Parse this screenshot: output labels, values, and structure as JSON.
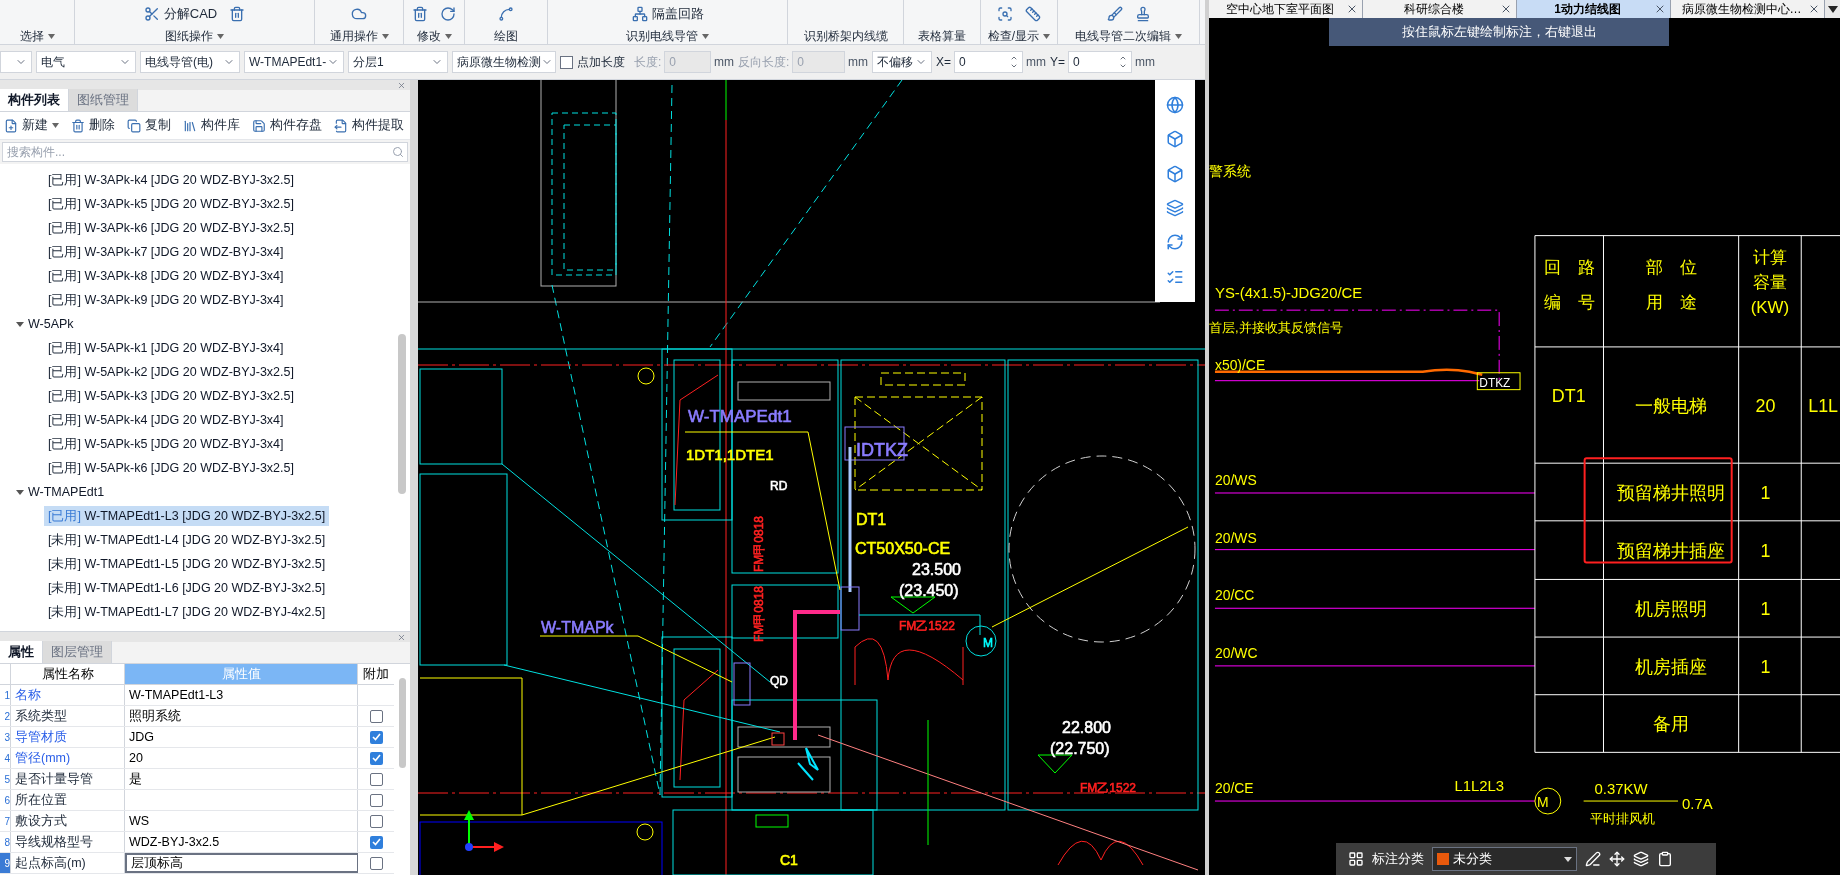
{
  "ribbon": {
    "groups": [
      {
        "label": "选择"
      },
      {
        "label": "图纸操作",
        "tools": [
          {
            "label": "分解CAD"
          }
        ]
      },
      {
        "label": "通用操作"
      },
      {
        "label": "修改"
      },
      {
        "label": "绘图"
      },
      {
        "label": "识别电线导管",
        "tools": [
          {
            "label": "隔盖回路"
          }
        ]
      },
      {
        "label": "识别桥架内线缆"
      },
      {
        "label": "表格算量"
      },
      {
        "label": "检查/显示"
      },
      {
        "label": "电线导管二次编辑"
      }
    ]
  },
  "options_bar": [
    {
      "kind": "select"
    },
    {
      "kind": "select",
      "value": "电气"
    },
    {
      "kind": "select",
      "value": "电线导管(电)"
    },
    {
      "kind": "select",
      "value": "W-TMAPEdt1-"
    },
    {
      "kind": "select",
      "value": "分层1"
    },
    {
      "kind": "select",
      "value": "病原微生物检测"
    },
    {
      "kind": "checkbox",
      "label": "点加长度",
      "checked": false
    },
    {
      "kind": "field",
      "label": "长度:",
      "value": "0",
      "unit": "mm",
      "disabled": true
    },
    {
      "kind": "field",
      "label": "反向长度:",
      "value": "0",
      "unit": "mm",
      "disabled": true
    },
    {
      "kind": "select",
      "value": "不偏移"
    },
    {
      "kind": "spin",
      "label": "X=",
      "value": "0",
      "unit": "mm"
    },
    {
      "kind": "spin",
      "label": "Y=",
      "value": "0",
      "unit": "mm"
    }
  ],
  "component_panel": {
    "tabs": [
      {
        "label": "构件列表",
        "selected": true
      },
      {
        "label": "图纸管理",
        "selected": false
      }
    ],
    "toolbar": [
      {
        "label": "新建",
        "caret": true
      },
      {
        "label": "删除"
      },
      {
        "label": "复制"
      },
      {
        "label": "构件库"
      },
      {
        "label": "构件存盘"
      },
      {
        "label": "构件提取"
      }
    ],
    "search": {
      "placeholder": "搜索构件..."
    },
    "tree": [
      {
        "children": [
          {
            "label": "[已用] W-3APk-k4 [JDG 20 WDZ-BYJ-3x2.5]",
            "selected": false
          },
          {
            "label": "[已用] W-3APk-k5 [JDG 20 WDZ-BYJ-3x2.5]",
            "selected": false
          },
          {
            "label": "[已用] W-3APk-k6 [JDG 20 WDZ-BYJ-3x2.5]",
            "selected": false
          },
          {
            "label": "[已用] W-3APk-k7 [JDG 20 WDZ-BYJ-3x4]",
            "selected": false
          },
          {
            "label": "[已用] W-3APk-k8 [JDG 20 WDZ-BYJ-3x4]",
            "selected": false
          },
          {
            "label": "[已用] W-3APk-k9 [JDG 20 WDZ-BYJ-3x4]",
            "selected": false
          }
        ]
      },
      {
        "label": "W-5APk",
        "expanded": true,
        "children": [
          {
            "label": "[已用] W-5APk-k1 [JDG 20 WDZ-BYJ-3x4]",
            "selected": false
          },
          {
            "label": "[已用] W-5APk-k2 [JDG 20 WDZ-BYJ-3x2.5]",
            "selected": false
          },
          {
            "label": "[已用] W-5APk-k3 [JDG 20 WDZ-BYJ-3x2.5]",
            "selected": false
          },
          {
            "label": "[已用] W-5APk-k4 [JDG 20 WDZ-BYJ-3x4]",
            "selected": false
          },
          {
            "label": "[已用] W-5APk-k5 [JDG 20 WDZ-BYJ-3x4]",
            "selected": false
          },
          {
            "label": "[已用] W-5APk-k6 [JDG 20 WDZ-BYJ-3x2.5]",
            "selected": false
          }
        ]
      },
      {
        "label": "W-TMAPEdt1",
        "expanded": true,
        "children": [
          {
            "label": "[已用] W-TMAPEdt1-L3 [JDG 20 WDZ-BYJ-3x2.5]",
            "selected": true
          },
          {
            "label": "[未用] W-TMAPEdt1-L4 [JDG 20 WDZ-BYJ-3x2.5]",
            "selected": false
          },
          {
            "label": "[未用] W-TMAPEdt1-L5 [JDG 20 WDZ-BYJ-3x2.5]",
            "selected": false
          },
          {
            "label": "[未用] W-TMAPEdt1-L6 [JDG 20 WDZ-BYJ-3x2.5]",
            "selected": false
          },
          {
            "label": "[未用] W-TMAPEdt1-L7 [JDG 20 WDZ-BYJ-4x2.5]",
            "selected": false
          }
        ]
      }
    ]
  },
  "property_panel": {
    "tabs": [
      {
        "label": "属性",
        "selected": true
      },
      {
        "label": "图层管理",
        "selected": false
      }
    ],
    "columns": [
      "属性名称",
      "属性值",
      "附加"
    ],
    "rows": [
      {
        "no": "1",
        "name": "名称",
        "value": "W-TMAPEdt1-L3",
        "highlighted": true,
        "editing": false
      },
      {
        "no": "2",
        "name": "系统类型",
        "value": "照明系统",
        "checked": false,
        "highlighted": false,
        "editing": false
      },
      {
        "no": "3",
        "name": "导管材质",
        "value": "JDG",
        "checked": true,
        "highlighted": true,
        "editing": false
      },
      {
        "no": "4",
        "name": "管径(mm)",
        "value": "20",
        "checked": true,
        "highlighted": true,
        "editing": false
      },
      {
        "no": "5",
        "name": "是否计量导管",
        "value": "是",
        "checked": false,
        "highlighted": false,
        "editing": false
      },
      {
        "no": "6",
        "name": "所在位置",
        "checked": false,
        "highlighted": false,
        "editing": false
      },
      {
        "no": "7",
        "name": "敷设方式",
        "value": "WS",
        "checked": false,
        "highlighted": false,
        "editing": false
      },
      {
        "no": "8",
        "name": "导线规格型号",
        "value": "WDZ-BYJ-3x2.5",
        "checked": true,
        "highlighted": false,
        "editing": false
      },
      {
        "no": "9",
        "name": "起点标高(m)",
        "value": "层顶标高",
        "checked": false,
        "highlighted": false,
        "editing": true
      }
    ]
  },
  "plan_labels": [
    {
      "text": "W-TMAPEdt1",
      "color": "#8a7cff"
    },
    {
      "text": "1DT1,1DTE1",
      "color": "#ffff00"
    },
    {
      "text": "RD",
      "color": "#ffffff"
    },
    {
      "text": "IDTKZ",
      "color": "#8a7cff"
    },
    {
      "text": "DT1",
      "color": "#ffff00"
    },
    {
      "text": "CT50X50-CE",
      "color": "#ffff00"
    },
    {
      "text": "23.500",
      "color": "#ffffff"
    },
    {
      "text": "(23.450)",
      "color": "#ffffff"
    },
    {
      "text": "FM甲0818",
      "color": "#ff2020"
    },
    {
      "text": "FM甲0818",
      "color": "#ff2020"
    },
    {
      "text": "W-TMAPk",
      "color": "#8a7cff"
    },
    {
      "text": "FM乙1522",
      "color": "#ff2020"
    },
    {
      "text": "QD",
      "color": "#ffffff"
    },
    {
      "text": "22.800",
      "color": "#ffffff"
    },
    {
      "text": "(22.750)",
      "color": "#ffffff"
    },
    {
      "text": "FM乙1522",
      "color": "#ff2020"
    },
    {
      "text": "M",
      "color": "#00ffff"
    },
    {
      "text": "C1",
      "color": "#ffff00"
    }
  ],
  "drawing_tabs": [
    {
      "label": "空中心地下室平面图",
      "selected": false
    },
    {
      "label": "科研综合楼",
      "selected": false
    },
    {
      "label": "1动力结线图",
      "selected": true
    },
    {
      "label": "病原微生物检测中心…",
      "selected": false
    }
  ],
  "hint_banner": "按住鼠标左键绘制标注，右键退出",
  "diagram_labels": [
    "警系统",
    "YS-(4x1.5)-JDG20/CE",
    "首层,并接收其反馈信号",
    "x50)/CE",
    "DTKZ",
    "20/WS",
    "20/WS",
    "20/CC",
    "20/WC",
    "20/CE",
    "L1L2L3",
    "M",
    "0.37KW",
    "平时排风机",
    "0.7A"
  ],
  "schedule_table": {
    "headers": [
      [
        "回　路",
        "编　号"
      ],
      [
        "部　位",
        "用　途"
      ],
      [
        "计算",
        "容量",
        "(KW)"
      ]
    ],
    "rows": [
      {
        "circuit": "DT1",
        "use": "一般电梯",
        "capacity": "20",
        "column_4": "L1L"
      },
      {
        "use": "预留梯井照明",
        "capacity": "1",
        "boxed": true
      },
      {
        "use": "预留梯井插座",
        "capacity": "1",
        "boxed": true
      },
      {
        "use": "机房照明",
        "capacity": "1"
      },
      {
        "use": "机房插座",
        "capacity": "1"
      },
      {
        "use": "备用"
      }
    ]
  },
  "annotation_toolbar": {
    "label": "标注分类",
    "category": {
      "value": "未分类",
      "color": "#e8590c"
    }
  }
}
